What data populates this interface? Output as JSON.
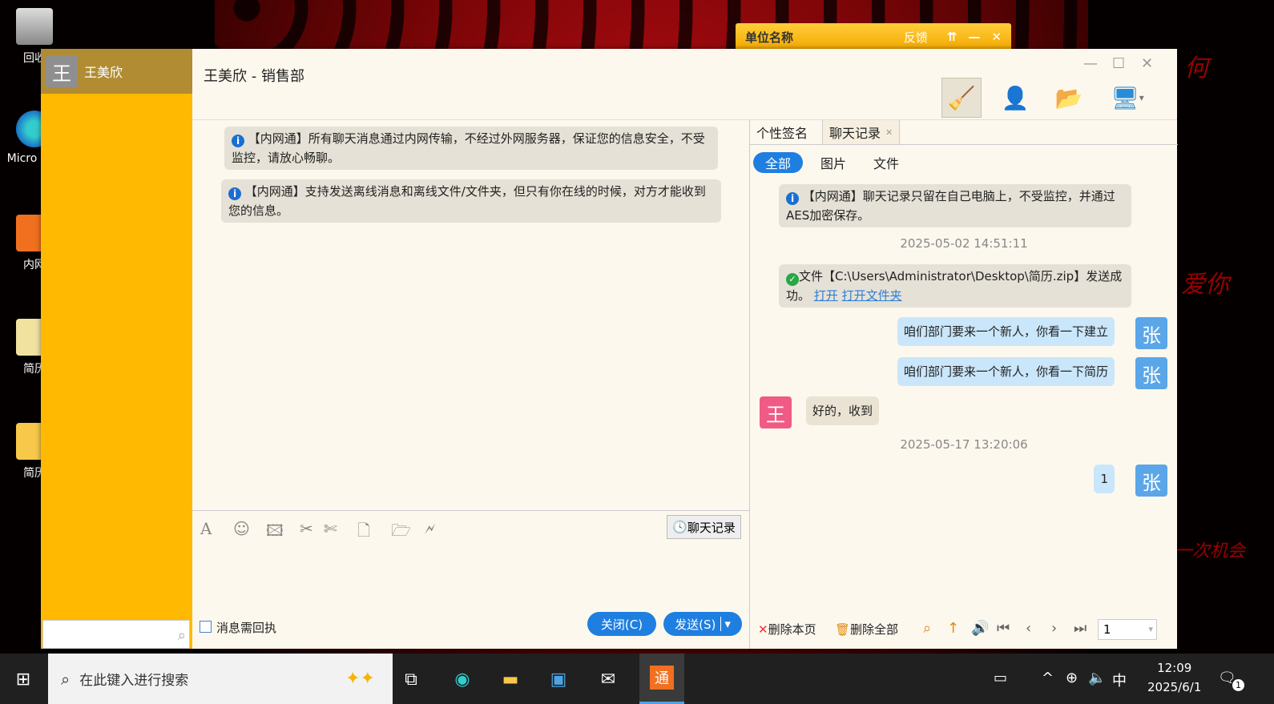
{
  "desktop": {
    "icons": [
      {
        "label": "回收"
      },
      {
        "label": "Micro Edg"
      },
      {
        "label": "内网"
      },
      {
        "label": "简历"
      },
      {
        "label": "简历"
      }
    ],
    "deco": [
      "何",
      "爱你",
      "一次机会"
    ]
  },
  "unit_bar": {
    "title": "单位名称",
    "feedback": "反馈",
    "pin": "⇈",
    "min": "—",
    "close": "✕"
  },
  "left": {
    "avatar": "王",
    "name": "王美欣",
    "search_placeholder": ""
  },
  "header": {
    "title": "王美欣 - 销售部",
    "min": "—",
    "max": "☐",
    "close": "✕",
    "tools": [
      {
        "icon": "broom-icon",
        "glyph": "🧹"
      },
      {
        "icon": "add-contact-icon",
        "glyph": "👤"
      },
      {
        "icon": "folder-icon",
        "glyph": "📂"
      },
      {
        "icon": "remote-desktop-icon",
        "glyph": "🖥"
      }
    ]
  },
  "chat": {
    "messages": [
      "【内网通】所有聊天消息通过内网传输，不经过外网服务器，保证您的信息安全，不受监控，请放心畅聊。",
      "【内网通】支持发送离线消息和离线文件/文件夹，但只有你在线的时候，对方才能收到您的信息。"
    ],
    "tools": [
      "A",
      "☺",
      "🖾",
      "✂",
      "✄",
      "🗋",
      "🗁",
      "🗲"
    ],
    "history_btn": "聊天记录",
    "receipt_label": "消息需回执",
    "close_btn": "关闭(C)",
    "send_btn": "发送(S)",
    "send_arrow": "▾"
  },
  "right": {
    "tabs": [
      "个性签名",
      "聊天记录"
    ],
    "tab_close": "✕",
    "filters": [
      "全部",
      "图片",
      "文件"
    ],
    "sys_msg": "【内网通】聊天记录只留在自己电脑上，不受监控，并通过AES加密保存。",
    "ts1": "2025-05-02 14:51:11",
    "file_msg": "文件【C:\\Users\\Administrator\\Desktop\\简历.zip】发送成功。",
    "open": "打开",
    "open_folder": "打开文件夹",
    "msg1": "咱们部门要来一个新人，你看一下建立",
    "msg2": "咱们部门要来一个新人，你看一下简历",
    "msg3": "好的，收到",
    "ts2": "2025-05-17 13:20:06",
    "msg4": "1",
    "me_avatar": "张",
    "them_avatar": "王",
    "del_page": "删除本页",
    "del_all": "删除全部",
    "page": "1"
  },
  "taskbar": {
    "search": "在此键入进行搜索",
    "time": "12:09",
    "date": "2025/6/1",
    "ime": "中",
    "notif": "1"
  },
  "colors": {
    "accent": "#1e7fe0",
    "left_panel": "#ffb900",
    "me_bubble": "#c9e6fb",
    "them_avatar": "#ef5b84",
    "me_avatar": "#5aa6e8"
  }
}
